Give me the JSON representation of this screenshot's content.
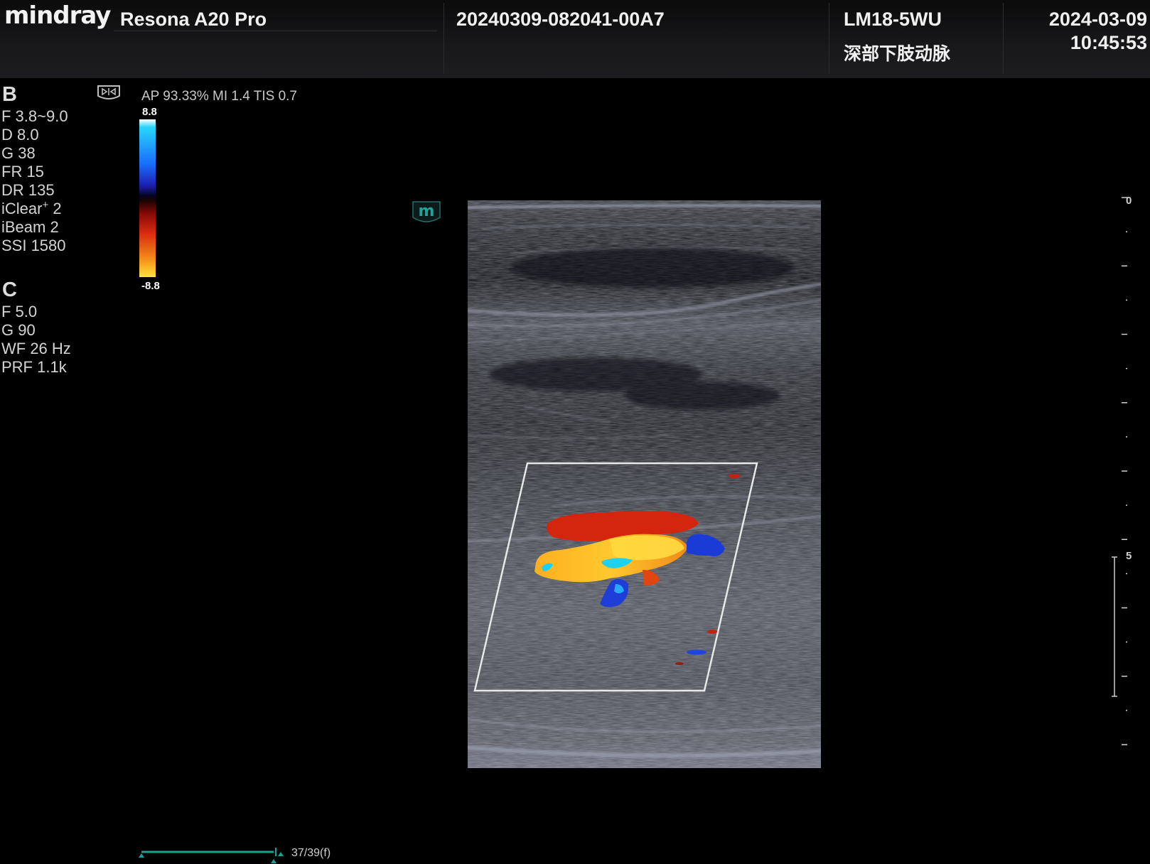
{
  "header": {
    "brand": "mindray",
    "system_name": "Resona A20 Pro",
    "exam_id": "20240309-082041-00A7",
    "probe": "LM18-5WU",
    "exam_preset": "深部下肢动脉",
    "date": "2024-03-09",
    "time": "10:45:53"
  },
  "b_mode": {
    "title": "B",
    "params": [
      {
        "id": "freq",
        "text": "F 3.8~9.0"
      },
      {
        "id": "depth",
        "text": "D 8.0"
      },
      {
        "id": "gain",
        "text": "G 38"
      },
      {
        "id": "framerate",
        "text": "FR 15"
      },
      {
        "id": "dynamic-range",
        "text": "DR 135"
      },
      {
        "id": "iclear",
        "text": "iClear",
        "sup": "+",
        "suffix": " 2"
      },
      {
        "id": "ibeam",
        "text": "iBeam 2"
      },
      {
        "id": "ssi",
        "text": "SSI 1580"
      }
    ]
  },
  "c_mode": {
    "title": "C",
    "params": [
      {
        "id": "freq",
        "text": "F 5.0"
      },
      {
        "id": "gain",
        "text": "G 90"
      },
      {
        "id": "wall-filter",
        "text": "WF 26 Hz"
      },
      {
        "id": "prf",
        "text": "PRF 1.1k"
      }
    ]
  },
  "acoustic": {
    "text": "AP 93.33%   MI 1.4  TIS 0.7"
  },
  "colorbar": {
    "max": "8.8",
    "min": "-8.8"
  },
  "logo_badge": {
    "text": "m"
  },
  "depth_scale": {
    "label_top": "0",
    "label_mid": "5",
    "max_depth_cm": 8
  },
  "cine": {
    "frame": "37/39(f)",
    "current": 37,
    "total": 39
  },
  "colors": {
    "accent": "#22a39a",
    "cine": "#1f9e95",
    "roi": "#e8e8e8"
  }
}
